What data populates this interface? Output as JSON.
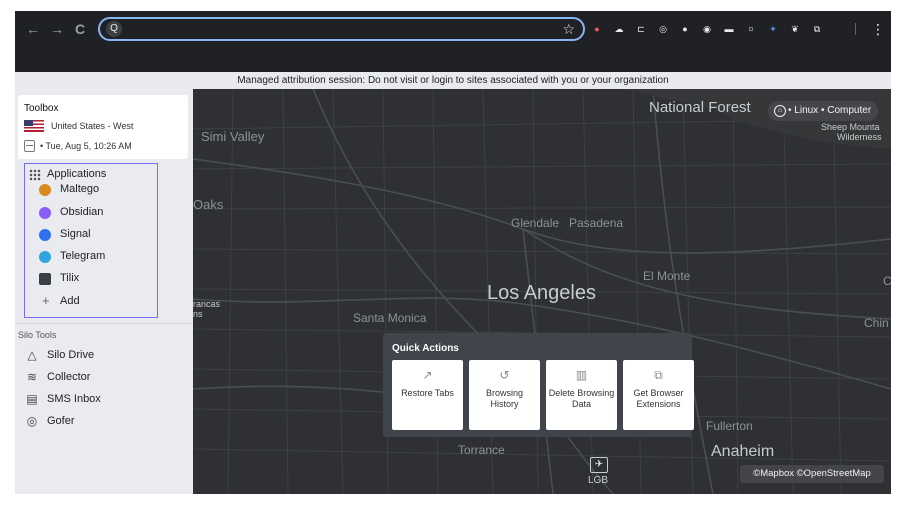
{
  "browser": {
    "nav": {
      "back": "←",
      "forward": "→",
      "reload": "C"
    },
    "omnibox": {
      "search_glyph": "Q",
      "value": "",
      "star_glyph": "☆"
    },
    "menu_glyph": "⋮",
    "extensions": [
      {
        "name": "us-flag-icon",
        "glyph": "●",
        "color": "#e55a5a"
      },
      {
        "name": "cloud-icon",
        "glyph": "☁",
        "color": "#e8eaed"
      },
      {
        "name": "tab-icon",
        "glyph": "⊏",
        "color": "#e8eaed"
      },
      {
        "name": "target-icon",
        "glyph": "◎",
        "color": "#e8eaed"
      },
      {
        "name": "shield-icon",
        "glyph": "●",
        "color": "#e8eaed"
      },
      {
        "name": "record-icon",
        "glyph": "◉",
        "color": "#e8eaed"
      },
      {
        "name": "sms-icon",
        "glyph": "▬",
        "color": "#e8eaed"
      },
      {
        "name": "bug-icon",
        "glyph": "¤",
        "color": "#9aa0a6"
      },
      {
        "name": "blue-ext-icon",
        "glyph": "✦",
        "color": "#5b8def"
      },
      {
        "name": "feather-icon",
        "glyph": "❦",
        "color": "#e8eaed"
      },
      {
        "name": "puzzle-icon",
        "glyph": "⧉",
        "color": "#e8eaed"
      }
    ]
  },
  "banner": {
    "text": "Managed attribution session: Do not visit or login to sites associated with you or your organization"
  },
  "toolbox": {
    "title": "Toolbox",
    "region": "United States - West",
    "datetime": "•  Tue, Aug 5, 10:26 AM"
  },
  "applications": {
    "title": "Applications",
    "items": [
      {
        "label": "Maltego",
        "color": "#d98b1c"
      },
      {
        "label": "Obsidian",
        "color": "#8b5cf6"
      },
      {
        "label": "Signal",
        "color": "#2f6ff1"
      },
      {
        "label": "Telegram",
        "color": "#2ca5e0"
      },
      {
        "label": "Tilix",
        "color": "#3b3f45"
      }
    ],
    "add_label": "Add",
    "add_glyph": "+"
  },
  "silo_tools": {
    "title": "Silo Tools",
    "items": [
      {
        "label": "Silo Drive",
        "glyph": "△"
      },
      {
        "label": "Collector",
        "glyph": "≋"
      },
      {
        "label": "SMS Inbox",
        "glyph": "▤"
      },
      {
        "label": "Gofer",
        "glyph": "◎"
      }
    ]
  },
  "map": {
    "labels": {
      "national_forest": "National Forest",
      "simi_valley": "Simi Valley",
      "sheep_mountain": "Sheep Mounta",
      "wilderness": "Wilderness",
      "oaks": "Oaks",
      "glendale": "Glendale",
      "pasadena": "Pasadena",
      "el_monte": "El Monte",
      "los_angeles": "Los Angeles",
      "francas": "rancas",
      "ns": "ns",
      "santa_monica": "Santa Monica",
      "chin": "Chin",
      "fullerton": "Fullerton",
      "anaheim": "Anaheim",
      "torrance": "Torrance",
      "c_edge": "C"
    },
    "os_badge": "•  Linux  •  Computer",
    "os_glyph": "⌂",
    "airport_glyph": "✈",
    "airport_label": "LGB",
    "attribution": "©Mapbox ©OpenStreetMap"
  },
  "quick_actions": {
    "title": "Quick Actions",
    "items": [
      {
        "label": "Restore Tabs",
        "glyph": "↗"
      },
      {
        "label": "Browsing History",
        "glyph": "↺"
      },
      {
        "label": "Delete Browsing Data",
        "glyph": "▥"
      },
      {
        "label": "Get Browser Extensions",
        "glyph": "⧉"
      }
    ]
  }
}
